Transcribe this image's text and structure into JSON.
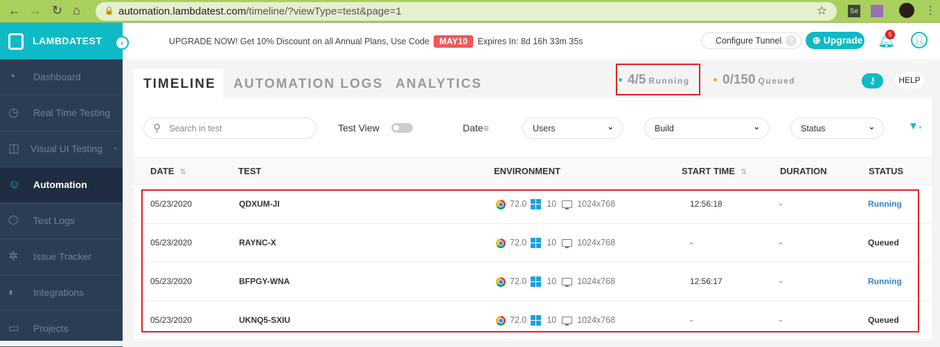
{
  "browser": {
    "url_host": "automation.lambdatest.com",
    "url_path": "/timeline/?viewType=test&page=1"
  },
  "brand": {
    "name": "LAMBDATEST",
    "accent": "#0ebac5",
    "sidebar_bg": "#2b3d55"
  },
  "sidebar": {
    "items": [
      {
        "label": "Dashboard",
        "icon": "gauge-icon"
      },
      {
        "label": "Real Time Testing",
        "icon": "clock-icon"
      },
      {
        "label": "Visual UI Testing",
        "icon": "eye-icon"
      },
      {
        "label": "Automation",
        "icon": "robot-icon",
        "active": true
      },
      {
        "label": "Test Logs",
        "icon": "box-icon"
      },
      {
        "label": "Issue Tracker",
        "icon": "bug-icon"
      },
      {
        "label": "Integrations",
        "icon": "integrations-icon"
      },
      {
        "label": "Projects",
        "icon": "folder-icon"
      }
    ]
  },
  "promo": {
    "text": "UPGRADE NOW! Get 10% Discount on all Annual Plans, Use Code",
    "code": "MAY10",
    "expires": "Expires In: 8d 16h 33m 35s"
  },
  "header": {
    "tunnel": "Configure Tunnel",
    "tunnel_help": "?",
    "upgrade": "Upgrade",
    "notifications": "5"
  },
  "tabs": [
    "TIMELINE",
    "AUTOMATION LOGS",
    "ANALYTICS"
  ],
  "stats": {
    "running_value": "4/5",
    "running_label": "Running",
    "queued_value": "0/150",
    "queued_label": "Queued"
  },
  "help": "HELP",
  "filters": {
    "search_placeholder": "Search in test",
    "test_view": "Test View",
    "date": "Date",
    "users": "Users",
    "build": "Build",
    "status": "Status"
  },
  "table": {
    "headers": [
      "DATE",
      "TEST",
      "ENVIRONMENT",
      "START TIME",
      "DURATION",
      "STATUS"
    ],
    "rows": [
      {
        "date": "05/23/2020",
        "test": "QDXUM-JI",
        "browser": "72.0",
        "os": "10",
        "res": "1024x768",
        "start": "12:56:18",
        "duration": "-",
        "status": "Running"
      },
      {
        "date": "05/23/2020",
        "test": "RAYNC-X",
        "browser": "72.0",
        "os": "10",
        "res": "1024x768",
        "start": "-",
        "duration": "-",
        "status": "Queued"
      },
      {
        "date": "05/23/2020",
        "test": "BFPGY-WNA",
        "browser": "72.0",
        "os": "10",
        "res": "1024x768",
        "start": "12:56:17",
        "duration": "-",
        "status": "Running"
      },
      {
        "date": "05/23/2020",
        "test": "UKNQ5-SXIU",
        "browser": "72.0",
        "os": "10",
        "res": "1024x768",
        "start": "-",
        "duration": "-",
        "status": "Queued"
      }
    ]
  }
}
